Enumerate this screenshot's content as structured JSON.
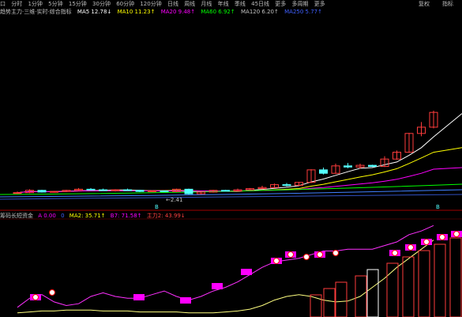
{
  "toolbar": {
    "window_icon": "口",
    "periods": [
      "分时",
      "1分钟",
      "5分钟",
      "15分钟",
      "30分钟",
      "60分钟",
      "120分钟",
      "日线",
      "周线",
      "月线",
      "年线",
      "季线",
      "45日线",
      "更多"
    ],
    "extra": "多周期",
    "more": "更多",
    "right_1": "复权",
    "right_2": "指标"
  },
  "main_indicators": {
    "title": "趋势主力·三维·实时·综合指标",
    "ma5": "MA5 12.78↓",
    "ma10": "MA10 11.23↑",
    "ma20": "MA20 9.48↑",
    "ma60": "MA60 6.92↑",
    "ma120": "MA120 6.20↑",
    "ma250": "MA250 5.77↑"
  },
  "sub_indicators": {
    "title": "筹码长短资金",
    "v1": "A 0.00",
    "v1b": "0",
    "ma2": "MA2: 35.71↑",
    "b7": "B7: 71.58↑",
    "main": "主力2: 43.99↓"
  },
  "markers": {
    "low_price": "←2.41",
    "tag1": "B",
    "tag2": "B"
  },
  "colors": {
    "bg": "#000000",
    "up": "#ff3c3c",
    "down": "#54ffff",
    "ma5": "#ffffff",
    "ma10": "#ffff00",
    "ma20": "#ff00ff",
    "ma60": "#00ff00",
    "ma120": "#4080ff",
    "sub_line": "#ff30ff",
    "sub_yellow": "#ffff80",
    "signal_box": "#ff00ff"
  },
  "chart_data": {
    "type": "candlestick",
    "candles": [
      [
        6.0,
        6.3,
        5.9,
        6.1
      ],
      [
        6.1,
        6.7,
        6.0,
        6.5
      ],
      [
        6.5,
        6.6,
        6.1,
        6.2
      ],
      [
        6.2,
        6.4,
        6.1,
        6.3
      ],
      [
        6.3,
        6.6,
        6.2,
        6.5
      ],
      [
        6.5,
        6.9,
        6.4,
        6.7
      ],
      [
        6.7,
        6.9,
        6.5,
        6.6
      ],
      [
        6.6,
        6.8,
        6.4,
        6.5
      ],
      [
        6.5,
        6.7,
        6.3,
        6.6
      ],
      [
        6.6,
        6.8,
        6.4,
        6.5
      ],
      [
        6.5,
        6.6,
        6.2,
        6.3
      ],
      [
        6.3,
        6.5,
        6.2,
        6.4
      ],
      [
        6.4,
        6.5,
        6.2,
        6.3
      ],
      [
        6.3,
        6.8,
        6.2,
        6.7
      ],
      [
        6.7,
        6.8,
        5.8,
        5.9
      ],
      [
        5.9,
        6.3,
        5.8,
        6.2
      ],
      [
        6.2,
        6.6,
        6.1,
        6.5
      ],
      [
        6.5,
        6.6,
        6.3,
        6.4
      ],
      [
        6.4,
        6.8,
        6.3,
        6.6
      ],
      [
        6.6,
        6.9,
        6.5,
        6.8
      ],
      [
        6.8,
        7.3,
        6.7,
        7.0
      ],
      [
        7.0,
        7.7,
        6.9,
        7.5
      ],
      [
        7.5,
        7.8,
        7.2,
        7.4
      ],
      [
        7.4,
        8.0,
        7.3,
        7.9
      ],
      [
        7.9,
        10.2,
        7.8,
        10.1
      ],
      [
        10.1,
        10.5,
        9.3,
        9.5
      ],
      [
        9.5,
        11.2,
        9.4,
        10.8
      ],
      [
        10.8,
        11.3,
        10.4,
        10.6
      ],
      [
        10.6,
        11.2,
        10.3,
        10.9
      ],
      [
        10.9,
        11.0,
        10.6,
        10.7
      ],
      [
        10.7,
        12.5,
        10.6,
        12.0
      ],
      [
        12.0,
        13.5,
        11.9,
        13.2
      ],
      [
        13.2,
        16.6,
        13.1,
        16.5
      ],
      [
        16.5,
        18.5,
        16.0,
        17.6
      ],
      [
        17.6,
        20.5,
        17.4,
        20.2
      ]
    ]
  }
}
